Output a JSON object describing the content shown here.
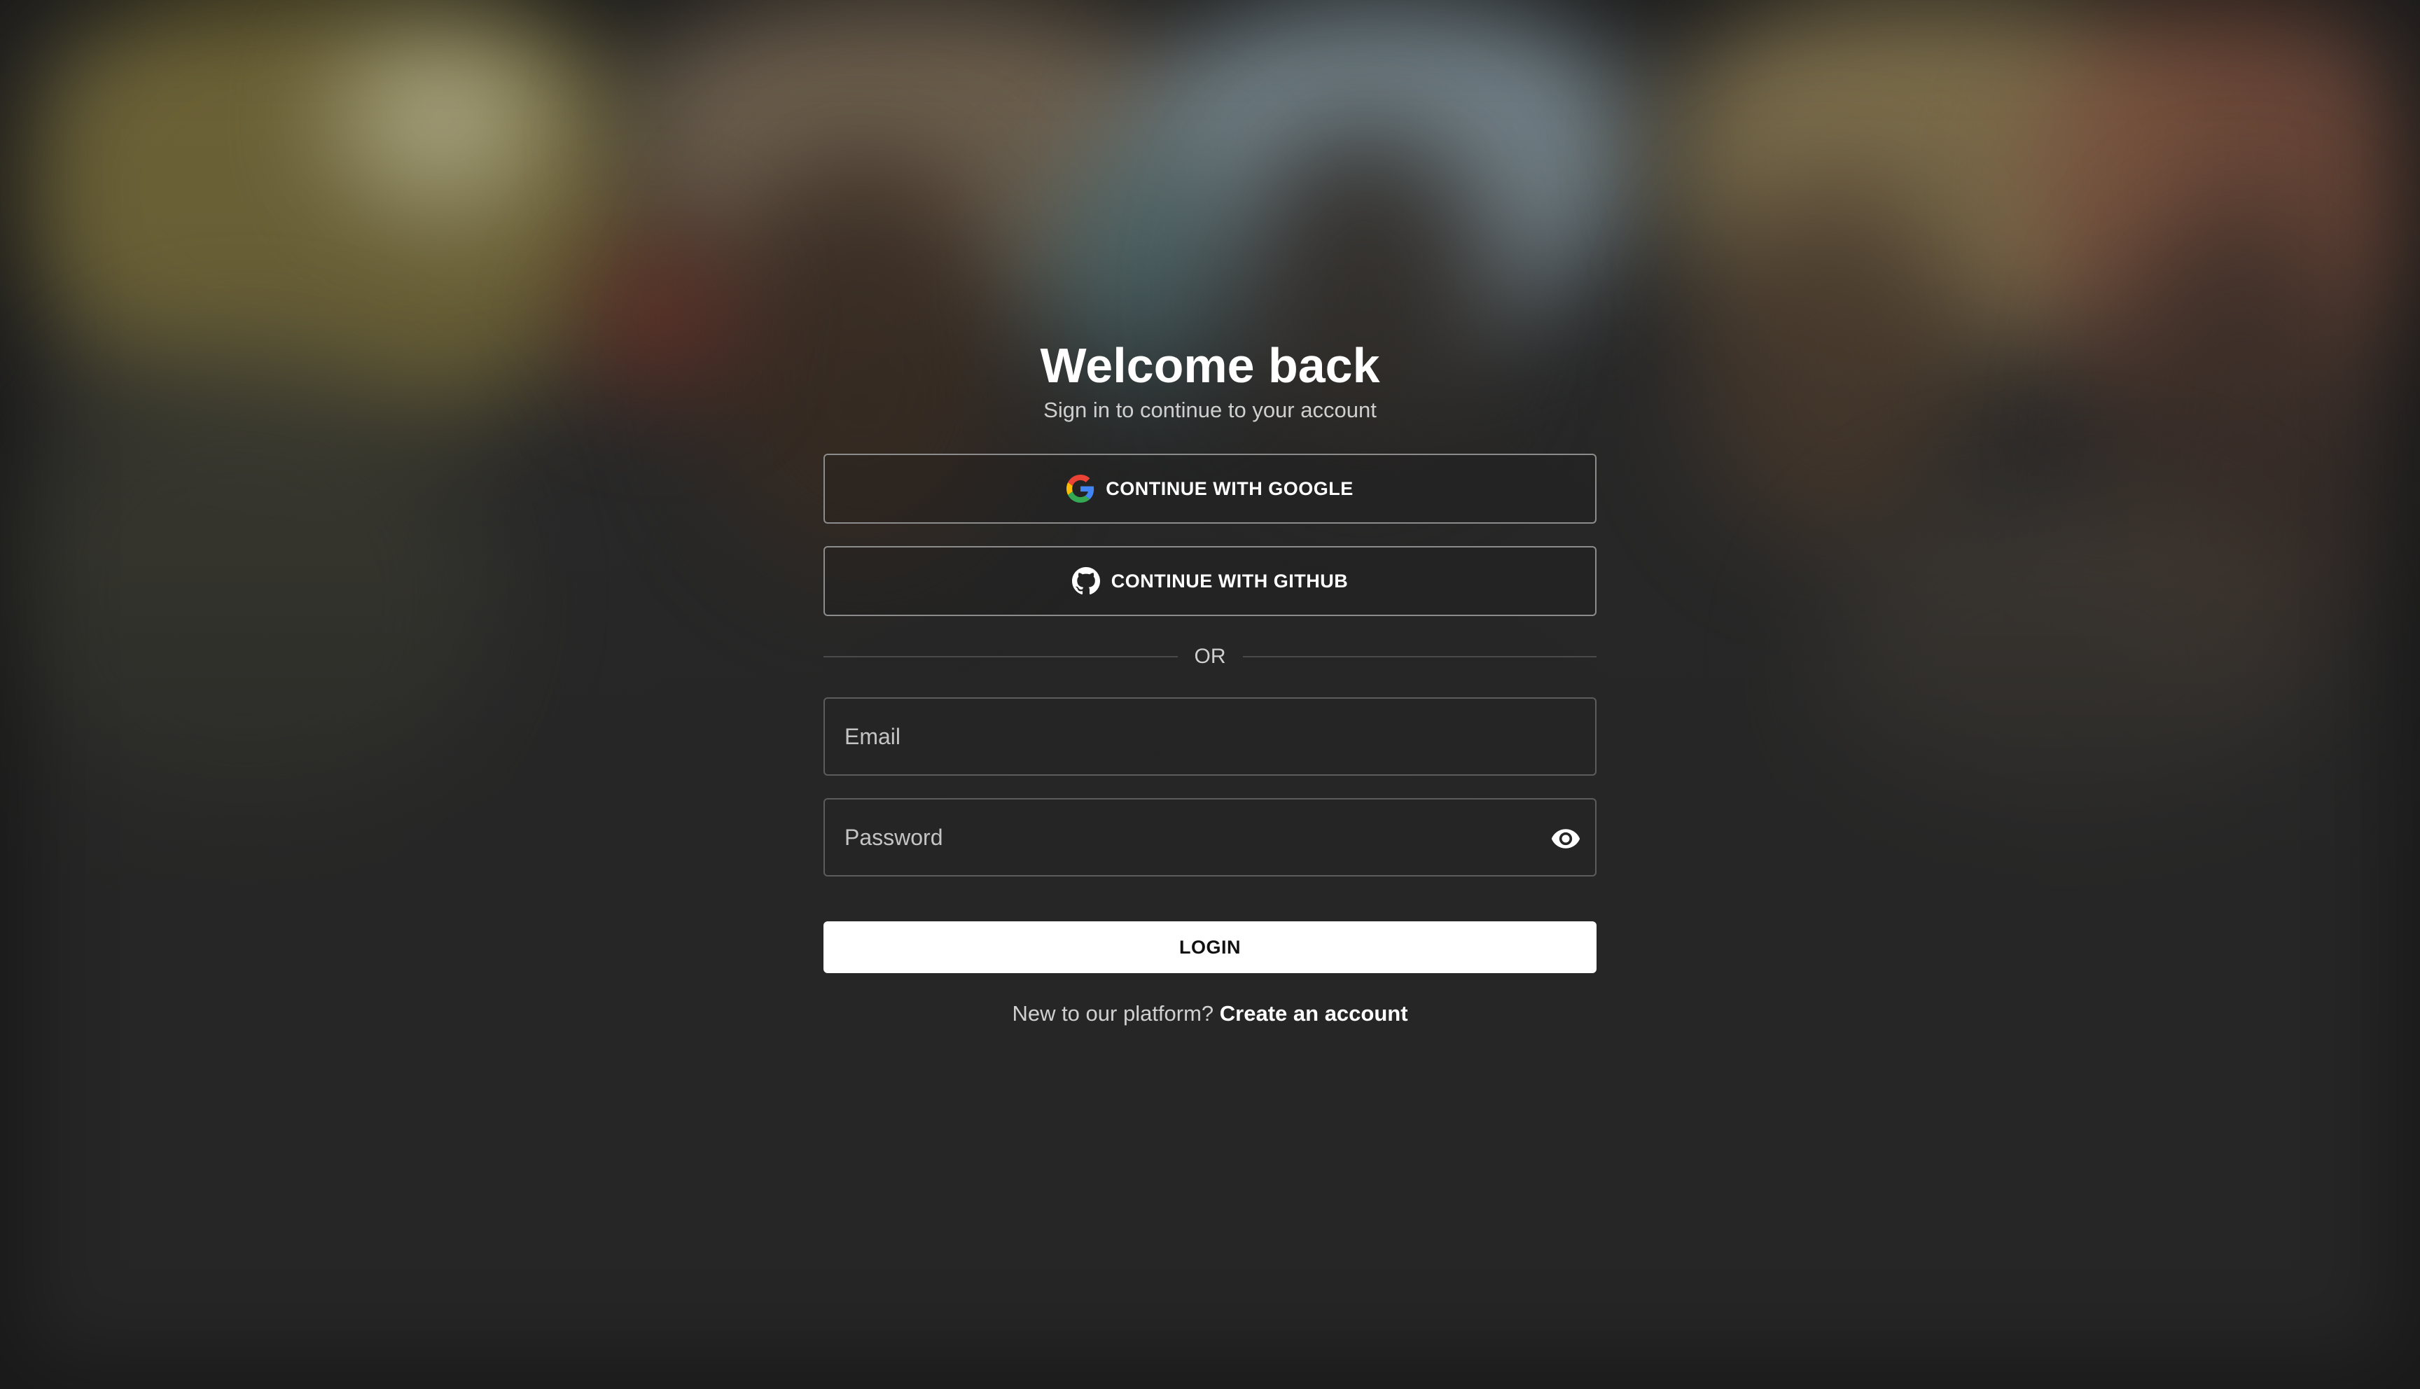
{
  "header": {
    "title": "Welcome back",
    "subtitle": "Sign in to continue to your account"
  },
  "oauth": {
    "google_label": "CONTINUE WITH GOOGLE",
    "github_label": "CONTINUE WITH GITHUB",
    "google_icon": "google-icon",
    "github_icon": "github-icon"
  },
  "divider": {
    "label": "OR"
  },
  "form": {
    "email_placeholder": "Email",
    "email_value": "",
    "password_placeholder": "Password",
    "password_value": "",
    "password_toggle_icon": "eye-icon",
    "login_label": "LOGIN"
  },
  "footer": {
    "prompt": "New to our platform?",
    "link_label": "Create an account"
  },
  "colors": {
    "background": "#262626",
    "primary_button": "#ffffff",
    "primary_button_text": "#111111",
    "outline": "#8c8c8c"
  }
}
